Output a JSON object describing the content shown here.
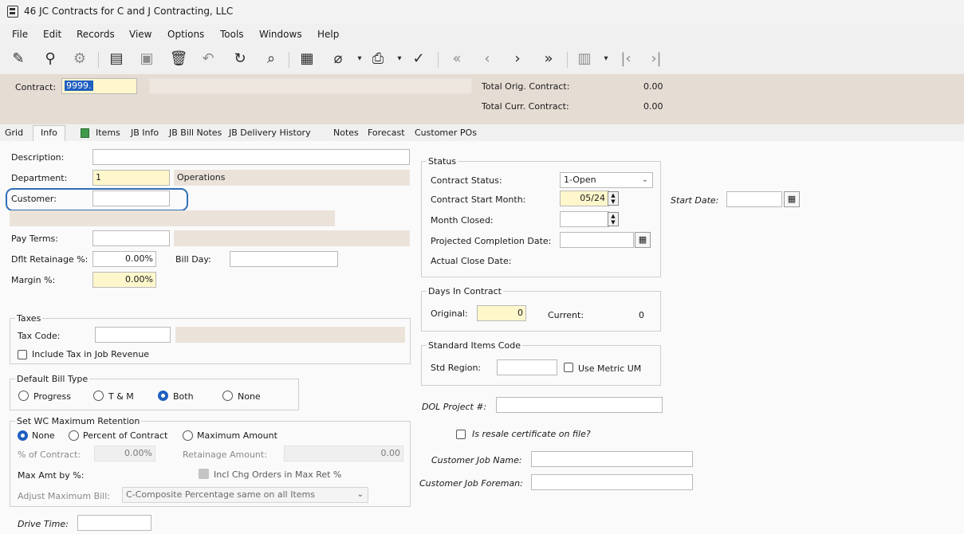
{
  "window": {
    "title": "46 JC Contracts for C and J Contracting, LLC"
  },
  "menu": [
    "File",
    "Edit",
    "Records",
    "View",
    "Options",
    "Tools",
    "Windows",
    "Help"
  ],
  "header": {
    "contract_label": "Contract:",
    "contract_value": "9999.",
    "total_orig_label": "Total Orig. Contract:",
    "total_orig_value": "0.00",
    "total_curr_label": "Total Curr. Contract:",
    "total_curr_value": "0.00"
  },
  "tabs": [
    "Grid",
    "Info",
    "Items",
    "JB Info",
    "JB Bill Notes",
    "JB Delivery History",
    "Notes",
    "Forecast",
    "Customer POs"
  ],
  "info": {
    "description_label": "Description:",
    "description_value": "",
    "department_label": "Department:",
    "department_value": "1",
    "department_name": "Operations",
    "customer_label": "Customer:",
    "customer_value": "",
    "pay_terms_label": "Pay Terms:",
    "dflt_retainage_label": "Dflt Retainage %:",
    "dflt_retainage_value": "0.00%",
    "bill_day_label": "Bill Day:",
    "margin_label": "Margin %:",
    "margin_value": "0.00%"
  },
  "taxes": {
    "title": "Taxes",
    "tax_code_label": "Tax Code:",
    "include_tax_label": "Include Tax in Job Revenue"
  },
  "bill_type": {
    "title": "Default Bill Type",
    "options": [
      "Progress",
      "T & M",
      "Both",
      "None"
    ],
    "selected": "Both"
  },
  "wc_retention": {
    "title": "Set WC Maximum Retention",
    "options": [
      "None",
      "Percent of Contract",
      "Maximum Amount"
    ],
    "selected": "None",
    "pct_contract_label": "% of Contract:",
    "pct_contract_value": "0.00%",
    "retainage_amount_label": "Retainage Amount:",
    "retainage_amount_value": "0.00",
    "max_amt_by_label": "Max Amt by %:",
    "incl_chg_label": "Incl Chg Orders in Max Ret %",
    "adjust_max_label": "Adjust Maximum Bill:",
    "adjust_max_value": "C-Composite Percentage same on all Items"
  },
  "drive_time_label": "Drive Time:",
  "status": {
    "title": "Status",
    "contract_status_label": "Contract Status:",
    "contract_status_value": "1-Open",
    "start_month_label": "Contract Start Month:",
    "start_month_value": "05/24",
    "month_closed_label": "Month Closed:",
    "projected_completion_label": "Projected Completion Date:",
    "actual_close_label": "Actual Close Date:",
    "start_date_label": "Start Date:"
  },
  "days": {
    "title": "Days In Contract",
    "original_label": "Original:",
    "original_value": "0",
    "current_label": "Current:",
    "current_value": "0"
  },
  "std_items": {
    "title": "Standard Items Code",
    "std_region_label": "Std Region:",
    "metric_label": "Use Metric UM"
  },
  "dol_label": "DOL Project #:",
  "resale_label": "Is resale certificate on file?",
  "customer_job_name_label": "Customer Job Name:",
  "customer_job_foreman_label": "Customer Job Foreman:"
}
